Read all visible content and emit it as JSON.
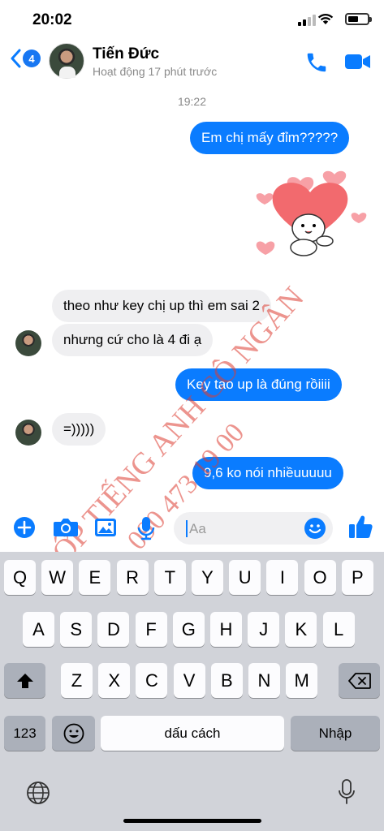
{
  "status_bar": {
    "time": "20:02"
  },
  "header": {
    "unread_count": "4",
    "name": "Tiến Đức",
    "status": "Hoạt động 17 phút trước"
  },
  "thread": {
    "timestamp": "19:22",
    "messages": [
      {
        "from": "me",
        "text": "Em chị mấy đỉm?????"
      },
      {
        "from": "me",
        "type": "sticker",
        "icon": "heart-character-sticker"
      },
      {
        "from": "them",
        "text": "theo như key chị up thì em sai 2"
      },
      {
        "from": "them",
        "text": "nhưng cứ cho là 4 đi ạ"
      },
      {
        "from": "me",
        "text": "Key tao up là đúng rồiiii"
      },
      {
        "from": "them",
        "text": "=)))))"
      },
      {
        "from": "me",
        "text": "9,6 ko nói nhiềuuuuu"
      }
    ]
  },
  "watermark": {
    "line1": "LỚP TIẾNG ANH CÔ NGÂN",
    "line2": "090 473 19 00"
  },
  "composer": {
    "placeholder": "Aa"
  },
  "keyboard": {
    "row1": [
      "Q",
      "W",
      "E",
      "R",
      "T",
      "Y",
      "U",
      "I",
      "O",
      "P"
    ],
    "row2": [
      "A",
      "S",
      "D",
      "F",
      "G",
      "H",
      "J",
      "K",
      "L"
    ],
    "row3": [
      "Z",
      "X",
      "C",
      "V",
      "B",
      "N",
      "M"
    ],
    "numbers_key": "123",
    "space_key": "dấu cách",
    "return_key": "Nhập"
  },
  "colors": {
    "accent": "#0a7cff",
    "incoming_bubble": "#efeff1",
    "watermark": "#dc3c32"
  }
}
